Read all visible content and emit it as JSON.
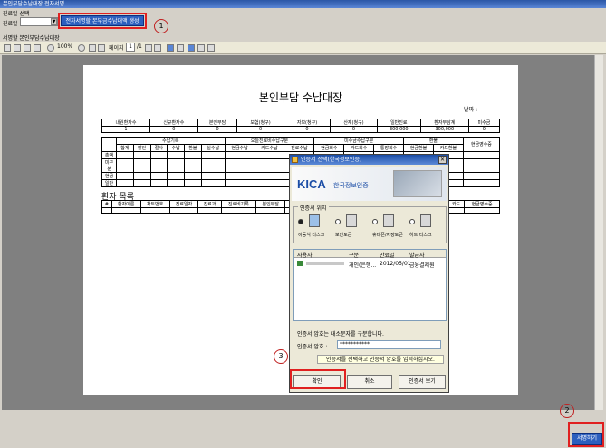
{
  "window": {
    "title": "본인부담수납대장 전자서명"
  },
  "search": {
    "section_label": "진료일 선택",
    "date_label": "진료일",
    "date_value": "",
    "generate_button": "전자서명할 본부금수납대액 생성"
  },
  "viewer_header": "서명할 본인부담수납대장",
  "toolbar": {
    "zoom": "100%",
    "page_label": "페이지",
    "page_current": "1",
    "page_total": "/1"
  },
  "report": {
    "title": "본인부담 수납대장",
    "date_label": "날짜 :",
    "summary_headers": [
      "내원환자수",
      "신규환자수",
      "본인부담",
      "보험(청구)",
      "자보(청구)",
      "산재(청구)",
      "일반진료",
      "환자부담계",
      "미수금"
    ],
    "summary_values": [
      "1",
      "0",
      "0",
      "0",
      "0",
      "0",
      "300,000",
      "300,000",
      "0"
    ],
    "group_headers": [
      "수납기록",
      "오늘진료비수납구분",
      "미수금수납구분",
      "환불"
    ],
    "sub_headers": [
      "합계",
      "할인",
      "절사",
      "수납",
      "환불",
      "실수납",
      "현금수납",
      "카드수납",
      "진료수납",
      "현금회수",
      "카드회수",
      "통장회수",
      "현금환불",
      "카드환불",
      "현금영수증"
    ],
    "row_labels": [
      "총액",
      "미구분",
      "현금",
      "일반"
    ],
    "patient_list_label": "환자 목록",
    "patient_headers": [
      "#",
      "환자이름",
      "차트번호",
      "진료일자",
      "진료과",
      "진료비기록",
      "본인부담",
      "보험청구",
      "일반진료",
      "구분",
      "미수금",
      "할인",
      "절사"
    ],
    "patient_extra_headers": [
      "환불",
      "현금",
      "카드",
      "현금영수증"
    ]
  },
  "dialog": {
    "title": "인증서 선택(한국정보인증)",
    "brand": "한국정보인증",
    "brand_mark": "KICA",
    "location_label": "인증서 위치",
    "locations": [
      "이동식 디스크",
      "보안토큰",
      "휴대폰/저장토큰",
      "하드 디스크"
    ],
    "columns": [
      "사용자",
      "구분",
      "만료일",
      "발급자"
    ],
    "cert_row": {
      "user": "",
      "type": "개인(은행...",
      "expiry": "2012/05/01",
      "issuer": "금융결제원"
    },
    "password_notice": "인증서 암호는 대소문자를 구분합니다.",
    "password_label": "인증서 암호 :",
    "password_value": "***********",
    "hint": "인증서를 선택하고 인증서 암호를 입력하십시오.",
    "confirm_button": "확인",
    "cancel_button": "취소",
    "view_button": "인증서 보기"
  },
  "annotations": [
    "1",
    "2",
    "3"
  ],
  "sign_button": "서명하기"
}
